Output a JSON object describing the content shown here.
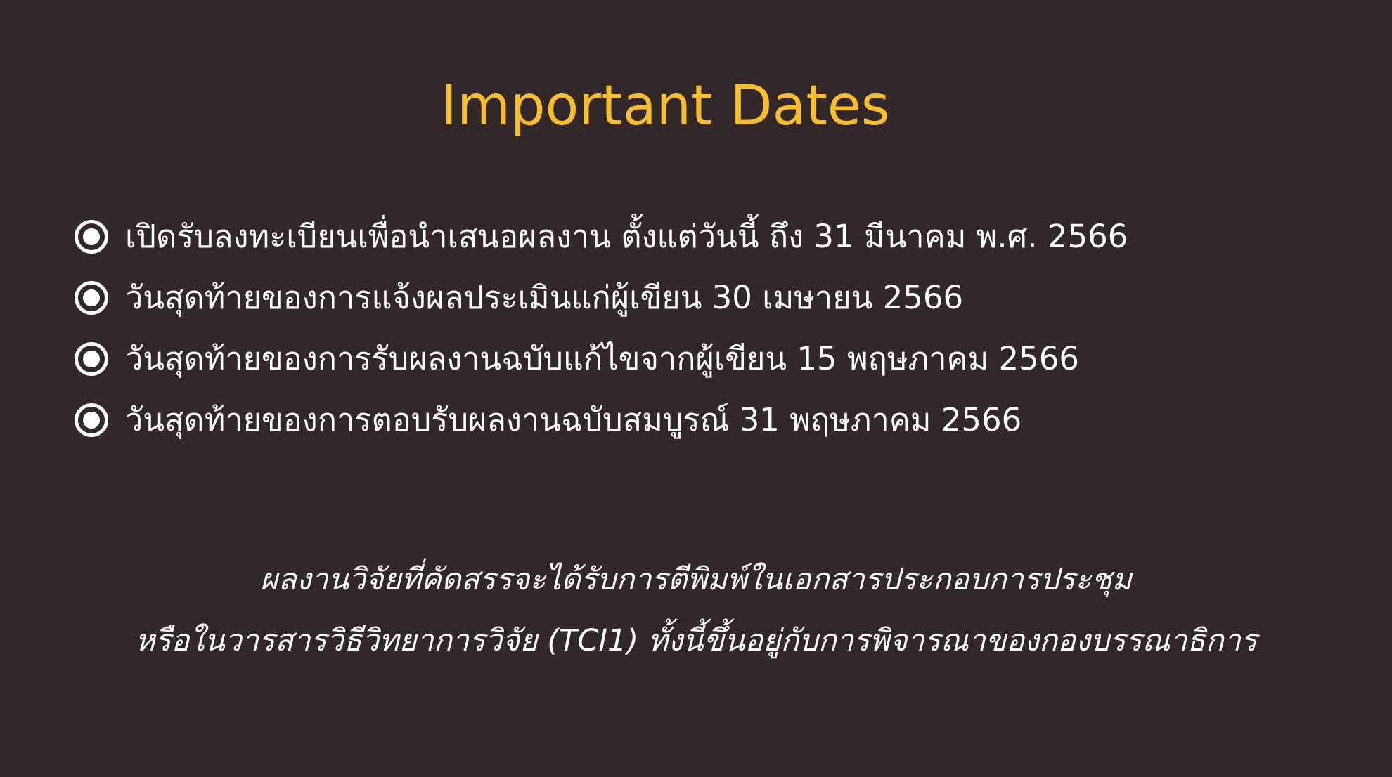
{
  "title": "Important Dates",
  "colors": {
    "background": "#322729",
    "title": "#F8BF2A",
    "text": "#FFFFFF"
  },
  "dates": [
    {
      "icon": "radio-bullet-icon",
      "text": "เปิดรับลงทะเบียนเพื่อนำเสนอผลงาน ตั้งแต่วันนี้ ถึง 31 มีนาคม พ.ศ. 2566"
    },
    {
      "icon": "radio-bullet-icon",
      "text": "วันสุดท้ายของการแจ้งผลประเมินแก่ผู้เขียน 30 เมษายน 2566"
    },
    {
      "icon": "radio-bullet-icon",
      "text": "วันสุดท้ายของการรับผลงานฉบับแก้ไขจากผู้เขียน 15 พฤษภาคม 2566"
    },
    {
      "icon": "radio-bullet-icon",
      "text": "วันสุดท้ายของการตอบรับผลงานฉบับสมบูรณ์ 31 พฤษภาคม 2566"
    }
  ],
  "note": {
    "line1": "ผลงานวิจัยที่คัดสรรจะได้รับการตีพิมพ์ในเอกสารประกอบการประชุม",
    "line2": "หรือในวารสารวิธีวิทยาการวิจัย (TCI1) ทั้งนี้ขึ้นอยู่กับการพิจารณาของกองบรรณาธิการ"
  }
}
